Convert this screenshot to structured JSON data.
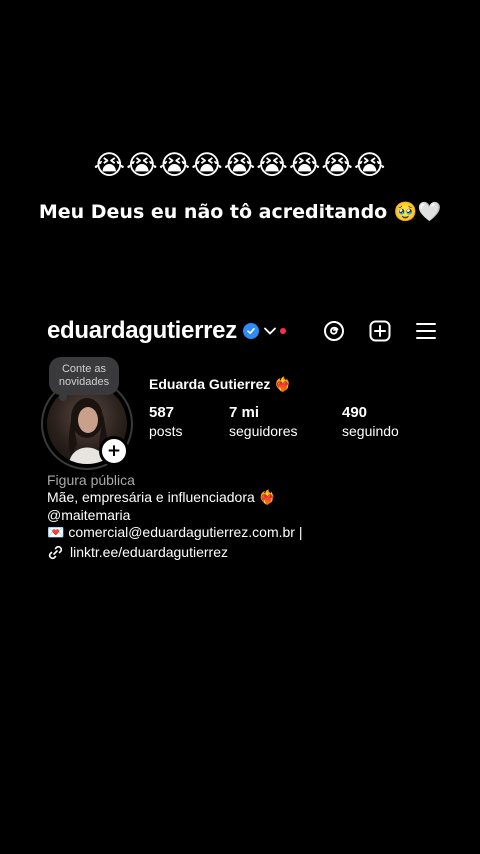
{
  "overlay": {
    "emojis": "😭😭😭😭😭😭😭😭😭",
    "caption": "Meu Deus eu não tô acreditando 🥹🤍"
  },
  "profile": {
    "username": "eduardagutierrez",
    "note": "Conte as novidades",
    "display_name": "Eduarda Gutierrez ❤️‍🔥",
    "stats": [
      {
        "value": "587",
        "label": "posts"
      },
      {
        "value": "7 mi",
        "label": "seguidores"
      },
      {
        "value": "490",
        "label": "seguindo"
      }
    ],
    "category": "Figura pública",
    "bio": {
      "line1": "Mãe, empresária e influenciadora ❤️‍🔥",
      "line2": "@maitemaria",
      "line3": "💌 comercial@eduardagutierrez.com.br |",
      "link": "linktr.ee/eduardagutierrez"
    }
  },
  "icons": {
    "verified": "verified-badge-icon",
    "dropdown": "chevron-down-icon",
    "threads": "threads-icon",
    "create": "plus-square-icon",
    "menu": "hamburger-menu-icon",
    "link": "link-icon",
    "add_story": "plus-icon"
  },
  "colors": {
    "background": "#000000",
    "verified": "#2f8cf5",
    "live_dot": "#ff2d55",
    "secondary_text": "#a8a8a8"
  }
}
